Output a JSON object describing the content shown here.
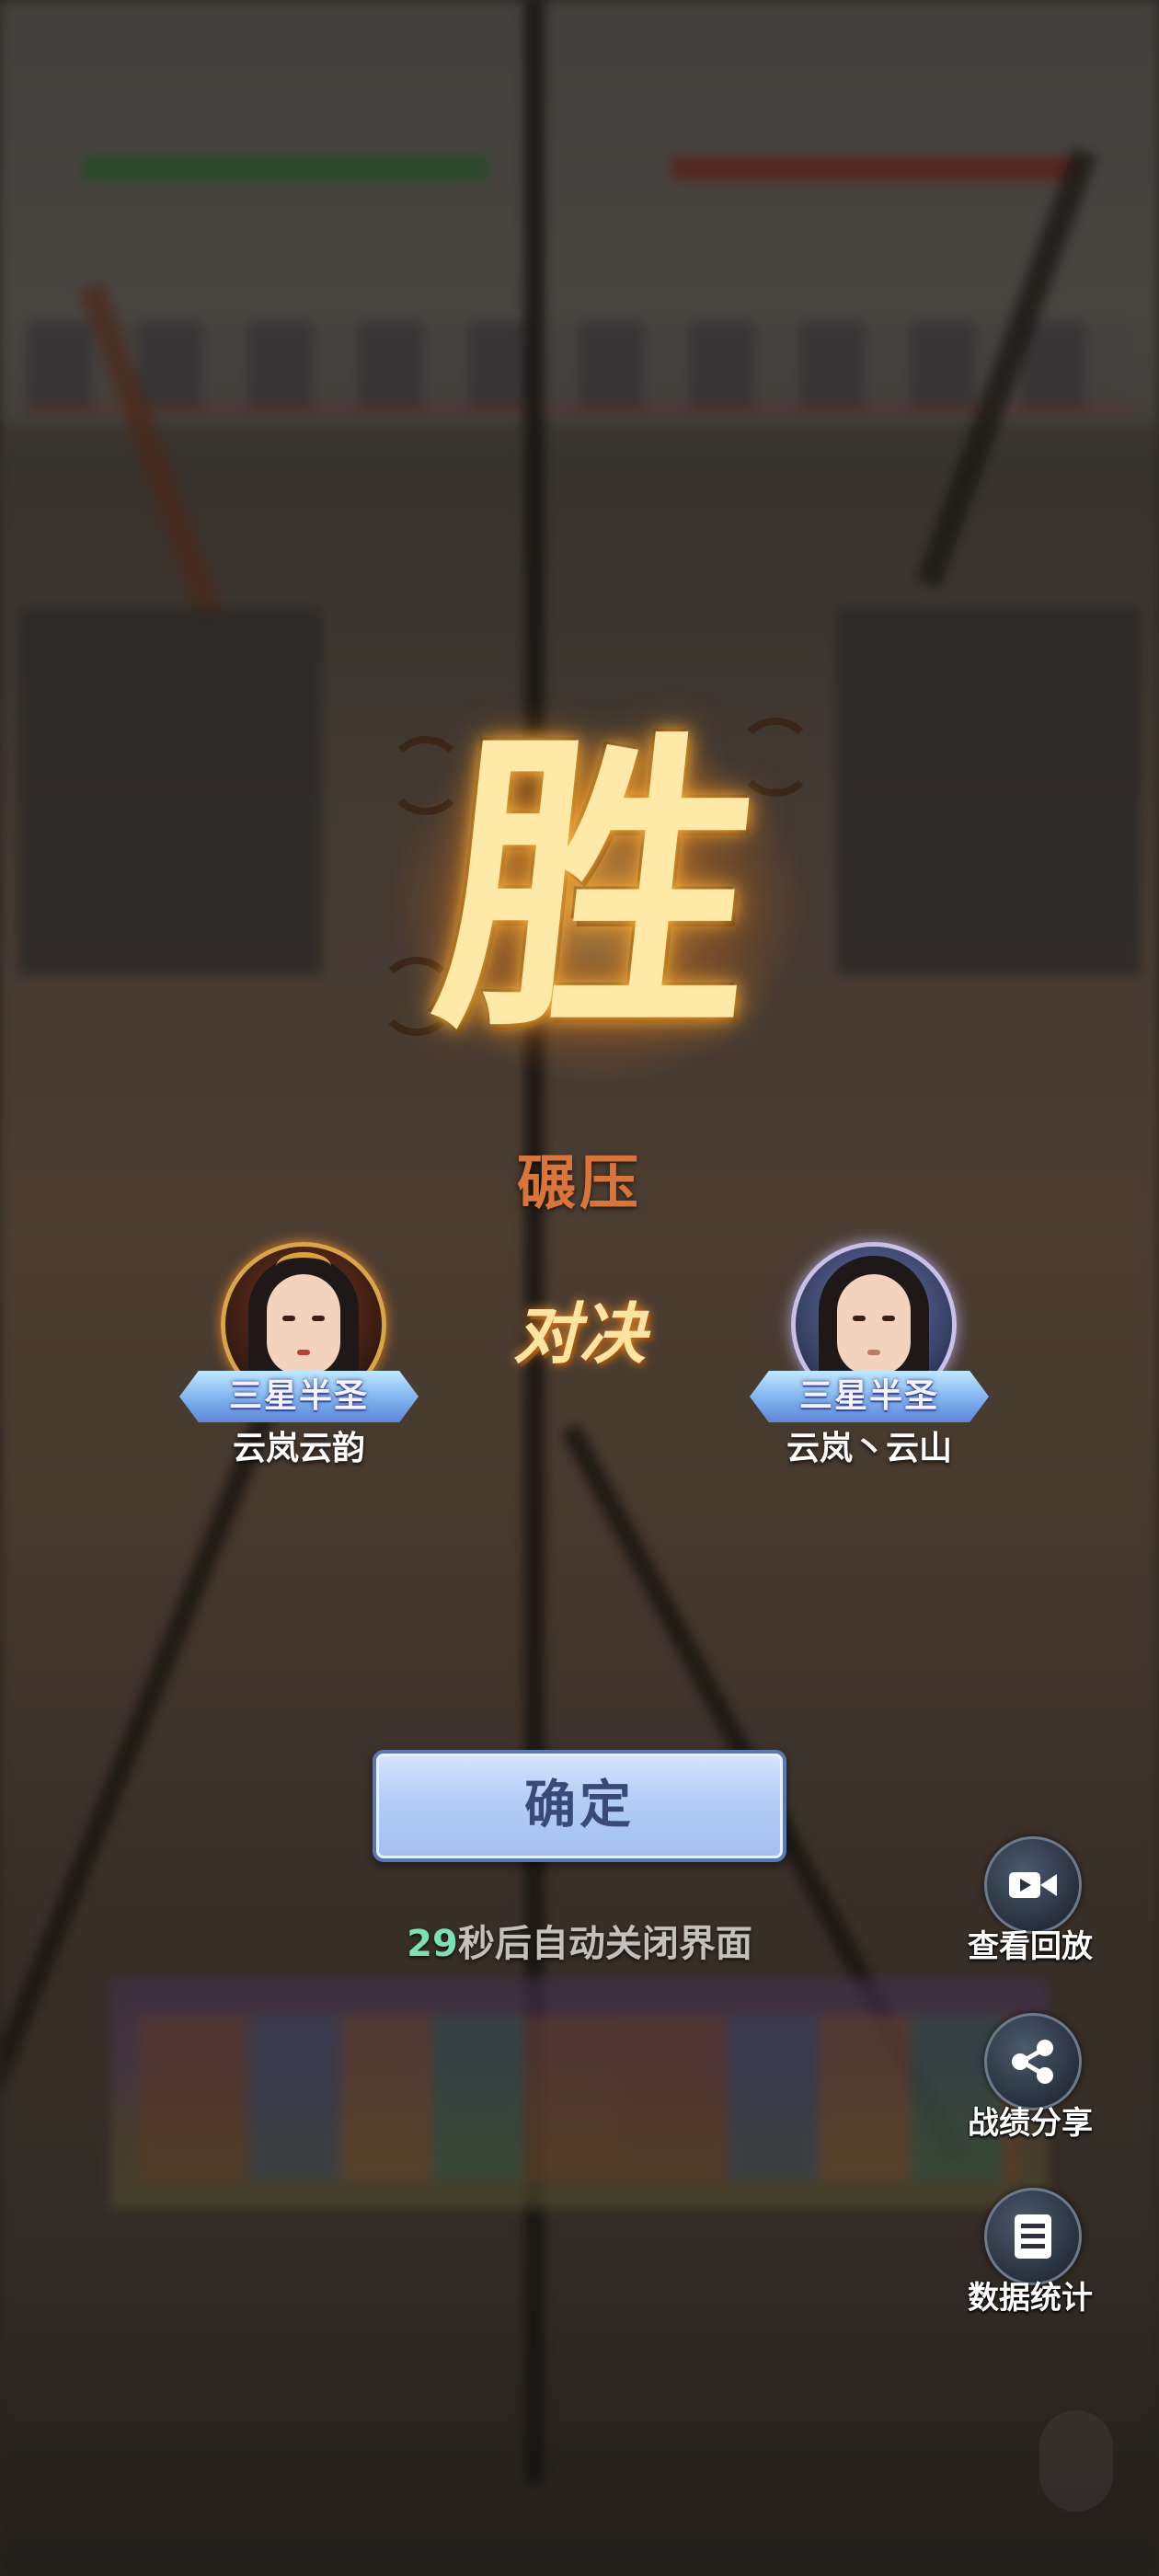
{
  "result": {
    "victory_char": "胜",
    "subtitle": "碾压",
    "vs_label": "对决"
  },
  "players": {
    "left": {
      "rank": "三星半圣",
      "name": "云岚云韵"
    },
    "right": {
      "rank": "三星半圣",
      "name": "云岚丶云山"
    }
  },
  "confirm_button": {
    "label": "确定"
  },
  "countdown": {
    "seconds": "29",
    "text": "秒后自动关闭界面"
  },
  "side_actions": [
    {
      "label": "查看回放",
      "icon": "video-camera-icon"
    },
    {
      "label": "战绩分享",
      "icon": "share-icon"
    },
    {
      "label": "数据统计",
      "icon": "list-icon"
    }
  ],
  "colors": {
    "subtitle": "#d9743a",
    "countdown_number": "#7de0b4",
    "button_text": "#3a4a78",
    "rank_badge": "#7fb2ee"
  }
}
